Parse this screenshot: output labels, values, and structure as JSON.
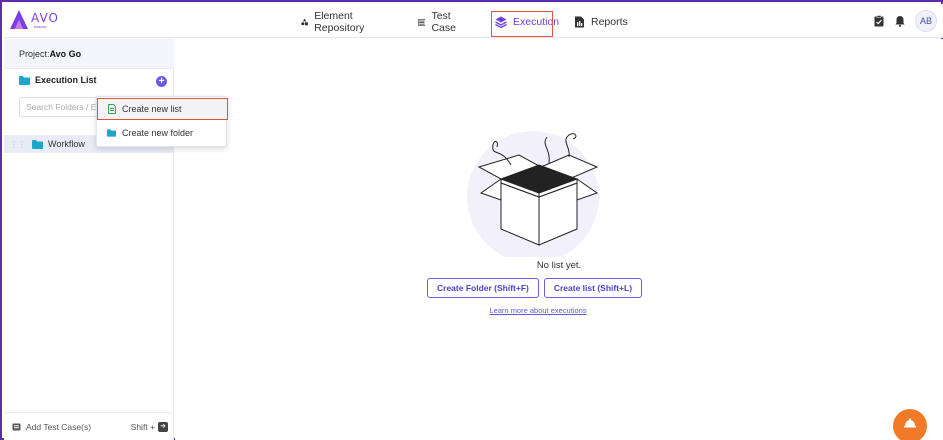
{
  "brand": {
    "name": "AVO",
    "subtitle": "Assure",
    "accent": "#6c3fe0"
  },
  "nav": {
    "items": [
      {
        "label": "Element Repository",
        "icon": "shapes-icon"
      },
      {
        "label": "Test Case",
        "icon": "list-icon"
      },
      {
        "label": "Execution",
        "icon": "layers-icon",
        "active": true
      },
      {
        "label": "Reports",
        "icon": "report-file-icon"
      }
    ]
  },
  "header": {
    "icons": [
      "clipboard-icon",
      "bell-icon"
    ],
    "avatar": "AB"
  },
  "sidebar": {
    "project_label": "Project:",
    "project_name": "Avo Go",
    "execution_list_label": "Execution List",
    "search_placeholder": "Search Folders / E",
    "tree": [
      {
        "label": "Workflow",
        "icon": "folder-icon"
      }
    ],
    "footer": {
      "add_label": "Add Test Case(s)",
      "shortcut": "Shift +"
    }
  },
  "dropdown": {
    "items": [
      {
        "label": "Create new list",
        "icon": "list-doc-icon",
        "highlighted": true
      },
      {
        "label": "Create new folder",
        "icon": "folder-icon"
      }
    ]
  },
  "main": {
    "empty_text": "No list yet.",
    "create_folder_btn": "Create Folder (Shift+F)",
    "create_list_btn": "Create list (Shift+L)",
    "learn_more": "Learn more about executions"
  },
  "colors": {
    "highlight_border": "#e2533a",
    "primary": "#6a5ce6",
    "folder": "#1aa7c9",
    "fab": "#f07a28"
  }
}
